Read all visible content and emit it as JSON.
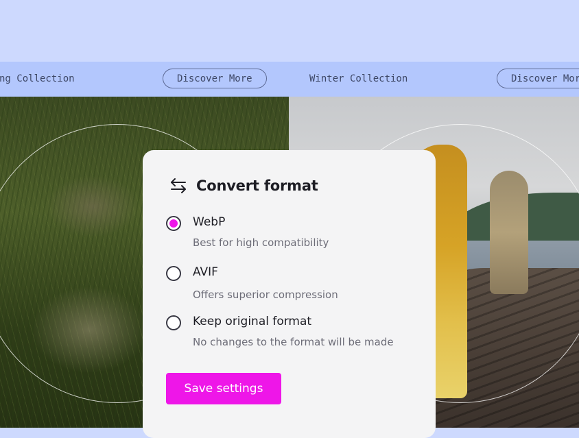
{
  "banner": {
    "items": [
      {
        "text": "ng Collection",
        "type": "label"
      },
      {
        "text": "Discover More",
        "type": "button"
      },
      {
        "text": "Winter Collection",
        "type": "label"
      },
      {
        "text": "Discover More",
        "type": "button"
      }
    ]
  },
  "dialog": {
    "icon": "swap-arrows-icon",
    "title": "Convert format",
    "options": [
      {
        "label": "WebP",
        "description": "Best for high compatibility",
        "selected": true
      },
      {
        "label": "AVIF",
        "description": "Offers superior compression",
        "selected": false
      },
      {
        "label": "Keep original format",
        "description": "No changes to the format will be made",
        "selected": false
      }
    ],
    "save_label": "Save settings"
  },
  "colors": {
    "accent": "#ee16e8",
    "banner_bg": "#b3c7fd",
    "page_bg": "#cdd9fe",
    "dialog_bg": "#f4f4f5"
  }
}
